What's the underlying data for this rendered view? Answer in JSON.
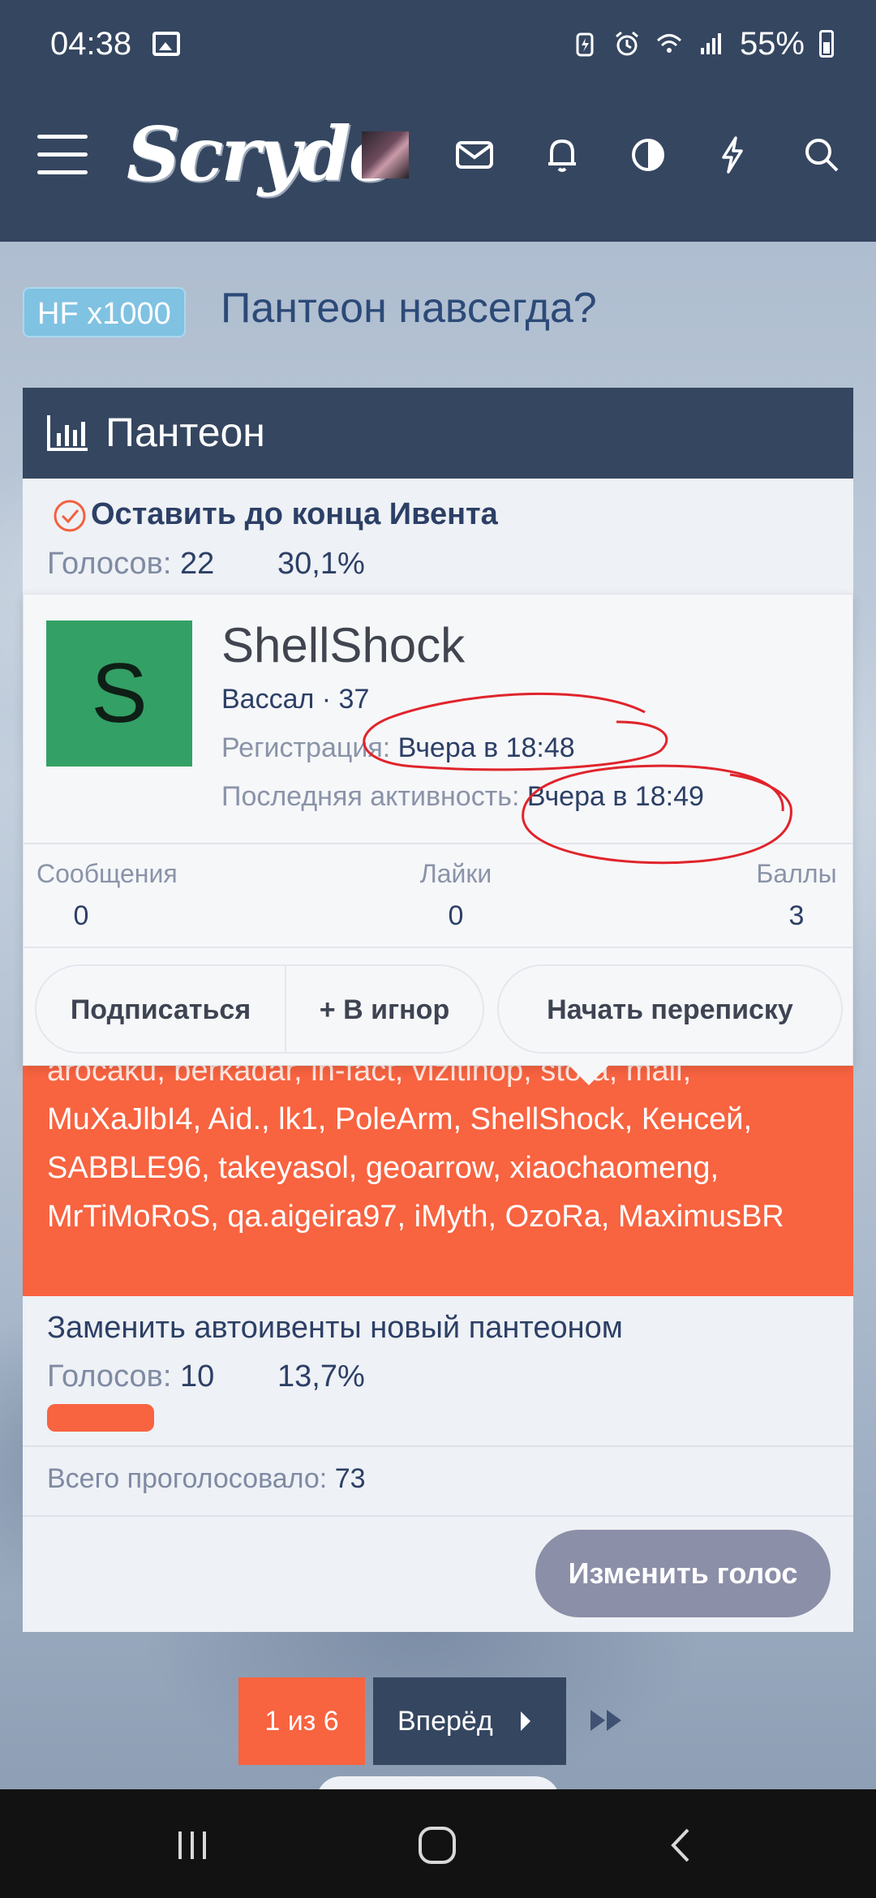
{
  "status_bar": {
    "time": "04:38",
    "battery_pct": "55%"
  },
  "header": {
    "logo": "Scryde",
    "icons": [
      "menu-icon",
      "mail-icon",
      "bell-icon",
      "contrast-icon",
      "lightning-icon",
      "search-icon"
    ]
  },
  "thread": {
    "prefix": "HF x1000",
    "title": "Пантеон навсегда?"
  },
  "poll": {
    "title": "Пантеон",
    "option1": {
      "label": "Оставить до конца Ивента",
      "votes_label": "Голосов:",
      "votes": "22",
      "percent": "30,1%",
      "fill": 0.301
    },
    "voters_cut_line": "aroсaku, berkadar, in-fact, vizitinop, stora, mail,",
    "voters_text": "MuXaJlbI4, Aid., lk1, PoleArm, ShellShock, Кенсей, SABBLE96, takeyasol, geoarrow, xiaochaomeng, MrTiMoRoS, qa.aigeira97, iMyth, OzoRa, MaximusBR",
    "option2": {
      "label": "Заменить автоивенты новый пантеоном",
      "votes_label": "Голосов:",
      "votes": "10",
      "percent": "13,7%",
      "fill": 0.137
    },
    "total_label": "Всего проголосовало:",
    "total": "73",
    "change_vote": "Изменить голос"
  },
  "member_card": {
    "avatar_letter": "S",
    "avatar_color": "#33a065",
    "name": "ShellShock",
    "rank": "Вассал · 37",
    "registration_label": "Регистрация:",
    "registration": "Вчера в 18:48",
    "last_activity_label": "Последняя активность:",
    "last_activity": "Вчера в 18:49",
    "stats": [
      {
        "label": "Сообщения",
        "value": "0"
      },
      {
        "label": "Лайки",
        "value": "0"
      },
      {
        "label": "Баллы",
        "value": "3"
      }
    ],
    "buttons": {
      "follow": "Подписаться",
      "ignore": "+ В игнор",
      "message": "Начать переписку"
    }
  },
  "pagination": {
    "current": "1 из 6",
    "next": "Вперёд"
  },
  "colors": {
    "header": "#354660",
    "accent": "#f86340",
    "prefix": "#7fc2e2",
    "annotation": "#e0242b"
  }
}
